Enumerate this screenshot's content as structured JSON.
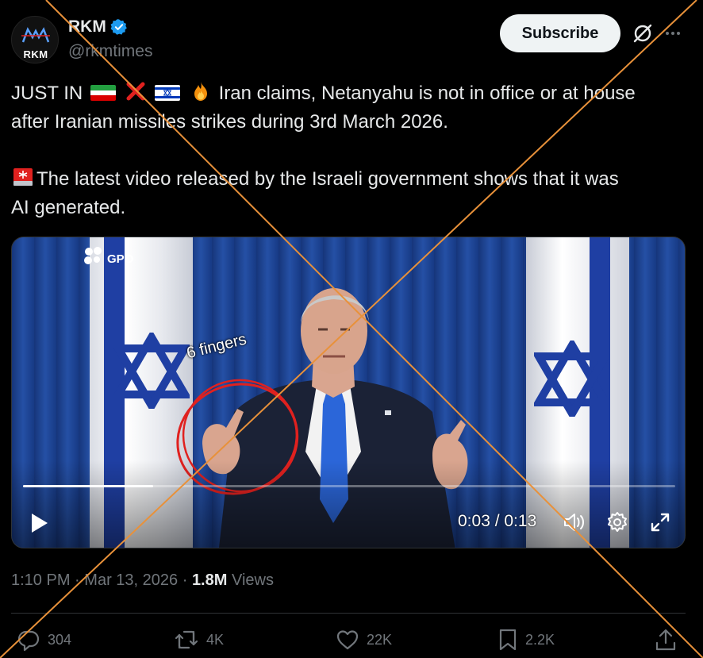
{
  "author": {
    "display_name": "RKM",
    "handle": "@rkmtimes",
    "avatar_text": "RKM",
    "verified": true,
    "verified_color": "#1d9bf0"
  },
  "header": {
    "subscribe_label": "Subscribe",
    "icons": [
      "grok-icon",
      "more-icon"
    ]
  },
  "tweet": {
    "line1_prefix": "JUST IN",
    "line1_suffix": "Iran claims, Netanyahu is not in office or at house",
    "line2": "after Iranian missiles strikes during 3rd March 2026.",
    "line3_suffix": "The latest video released by the Israeli government shows that it was",
    "line4": "AI generated.",
    "emojis": [
      "iran-flag",
      "cross-mark",
      "israel-flag",
      "fire",
      "siren"
    ]
  },
  "media": {
    "watermark": "GPO",
    "annotation": "6 fingers",
    "annotation_color": "#e0211f",
    "time_display": "0:03 / 0:13",
    "progress": 0.2
  },
  "meta": {
    "time": "1:10 PM",
    "separator": "·",
    "date": "Mar 13, 2026",
    "views_count": "1.8M",
    "views_label": "Views"
  },
  "actions": {
    "replies": "304",
    "reposts": "4K",
    "likes": "22K",
    "bookmarks": "2.2K"
  },
  "overlay": {
    "cross_color": "#e8913a"
  },
  "colors": {
    "background": "#000000",
    "text": "#e7e9ea",
    "muted": "#71767b",
    "accent": "#1d9bf0"
  }
}
